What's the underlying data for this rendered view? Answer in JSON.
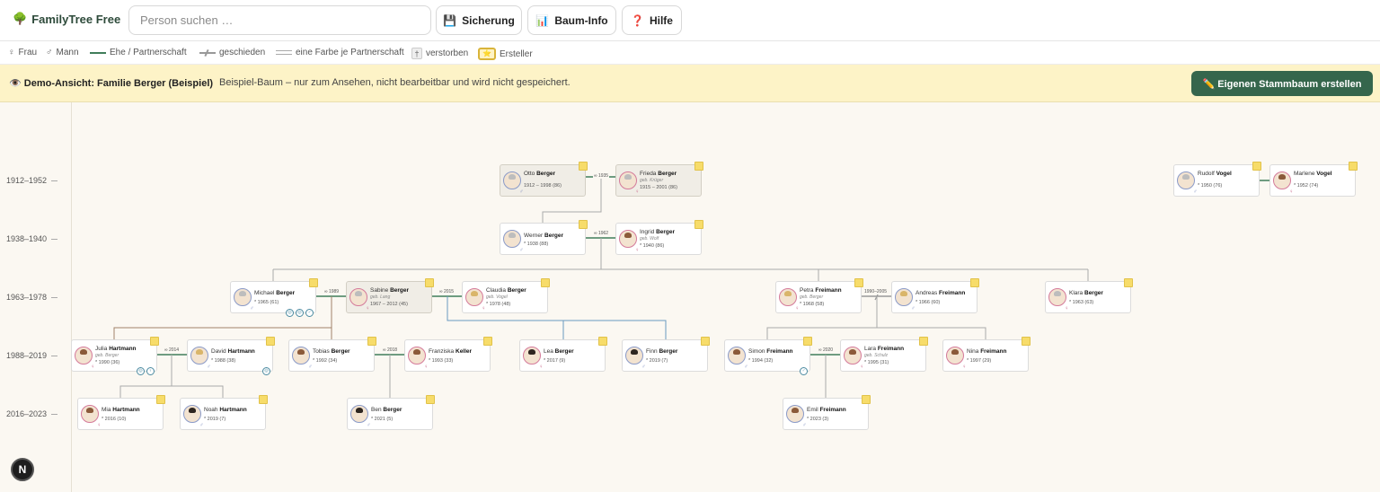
{
  "app": {
    "title": "FamilyTree Free"
  },
  "search": {
    "placeholder": "Person suchen …"
  },
  "toolbar": {
    "backup": {
      "icon": "floppy-disk-icon",
      "label": "Sicherung"
    },
    "tree_info": {
      "icon": "bar-chart-icon",
      "label": "Baum-Info"
    },
    "help": {
      "icon": "question-mark-icon",
      "label": "Hilfe"
    }
  },
  "legend": {
    "female": "Frau",
    "male": "Mann",
    "marriage": "Ehe / Partnerschaft",
    "divorced": "geschieden",
    "color_per_partnership": "eine Farbe je Partnerschaft",
    "deceased_symbol": "†",
    "deceased": "verstorben",
    "creator": "Ersteller"
  },
  "banner": {
    "title": "Demo-Ansicht: Familie Berger (Beispiel)",
    "text": "Beispiel-Baum – nur zum Ansehen, nicht bearbeitbar und wird nicht gespeichert.",
    "button": "✏️ Eigenen Stammbaum erstellen"
  },
  "generations": [
    "1912–1952",
    "1938–1940",
    "1963–1978",
    "1988–2019",
    "2016–2023"
  ],
  "marriage_years": {
    "otto_frieda": "∞ 1935",
    "werner_ingrid": "∞ 1962",
    "michael_sabine": "∞ 1989",
    "michael_claudia": "∞ 2015",
    "petra_andreas": "1990–2005",
    "julia_david": "∞ 2014",
    "tobias_franziska": "∞ 2018",
    "simon_lara": "∞ 2020"
  },
  "persons": [
    {
      "id": "otto",
      "first": "Otto",
      "last": "Berger",
      "dates": "1912 – 1998 (86)",
      "sex": "m",
      "dead": true
    },
    {
      "id": "frieda",
      "first": "Frieda",
      "last": "Berger",
      "birth_name": "geb. Krüger",
      "dates": "1915 – 2001 (86)",
      "sex": "f",
      "dead": true
    },
    {
      "id": "werner",
      "first": "Werner",
      "last": "Berger",
      "dates": "* 1938 (88)",
      "sex": "m"
    },
    {
      "id": "ingrid",
      "first": "Ingrid",
      "last": "Berger",
      "birth_name": "geb. Wolf",
      "dates": "* 1940 (86)",
      "sex": "f"
    },
    {
      "id": "michael",
      "first": "Michael",
      "last": "Berger",
      "dates": "* 1965 (61)",
      "sex": "m"
    },
    {
      "id": "sabine",
      "first": "Sabine",
      "last": "Berger",
      "birth_name": "geb. Lang",
      "dates": "1967 – 2012 (45)",
      "sex": "f",
      "dead": true
    },
    {
      "id": "claudia",
      "first": "Claudia",
      "last": "Berger",
      "birth_name": "geb. Vogel",
      "dates": "* 1978 (48)",
      "sex": "f"
    },
    {
      "id": "petra",
      "first": "Petra",
      "last": "Freimann",
      "birth_name": "geb. Berger",
      "dates": "* 1968 (58)",
      "sex": "f"
    },
    {
      "id": "andreas",
      "first": "Andreas",
      "last": "Freimann",
      "dates": "* 1966 (60)",
      "sex": "m"
    },
    {
      "id": "klara",
      "first": "Klara",
      "last": "Berger",
      "dates": "* 1963 (63)",
      "sex": "f"
    },
    {
      "id": "rudolf",
      "first": "Rudolf",
      "last": "Vogel",
      "dates": "* 1950 (76)",
      "sex": "m"
    },
    {
      "id": "marlene",
      "first": "Marlene",
      "last": "Vogel",
      "dates": "* 1952 (74)",
      "sex": "f"
    },
    {
      "id": "julia",
      "first": "Julia",
      "last": "Hartmann",
      "birth_name": "geb. Berger",
      "dates": "* 1990 (36)",
      "sex": "f"
    },
    {
      "id": "david",
      "first": "David",
      "last": "Hartmann",
      "dates": "* 1988 (38)",
      "sex": "m"
    },
    {
      "id": "tobias",
      "first": "Tobias",
      "last": "Berger",
      "dates": "* 1992 (34)",
      "sex": "m"
    },
    {
      "id": "franziska",
      "first": "Franziska",
      "last": "Keller",
      "dates": "* 1993 (33)",
      "sex": "f"
    },
    {
      "id": "lea",
      "first": "Lea",
      "last": "Berger",
      "dates": "* 2017 (9)",
      "sex": "f"
    },
    {
      "id": "finn",
      "first": "Finn",
      "last": "Berger",
      "dates": "* 2019 (7)",
      "sex": "m"
    },
    {
      "id": "simon",
      "first": "Simon",
      "last": "Freimann",
      "dates": "* 1994 (32)",
      "sex": "m"
    },
    {
      "id": "lara",
      "first": "Lara",
      "last": "Freimann",
      "birth_name": "geb. Schulz",
      "dates": "* 1995 (31)",
      "sex": "f"
    },
    {
      "id": "nina",
      "first": "Nina",
      "last": "Freimann",
      "dates": "* 1997 (29)",
      "sex": "f"
    },
    {
      "id": "mia",
      "first": "Mia",
      "last": "Hartmann",
      "dates": "* 2016 (10)",
      "sex": "f"
    },
    {
      "id": "noah",
      "first": "Noah",
      "last": "Hartmann",
      "dates": "* 2019 (7)",
      "sex": "m"
    },
    {
      "id": "ben",
      "first": "Ben",
      "last": "Berger",
      "dates": "* 2021 (5)",
      "sex": "m"
    },
    {
      "id": "emil",
      "first": "Emil",
      "last": "Freimann",
      "dates": "* 2023 (3)",
      "sex": "m"
    }
  ],
  "nav_badge": "N",
  "colors": {
    "accent": "#35664c",
    "marriage_line": "#3f7d5a",
    "banner_bg": "#fdf3c7"
  }
}
